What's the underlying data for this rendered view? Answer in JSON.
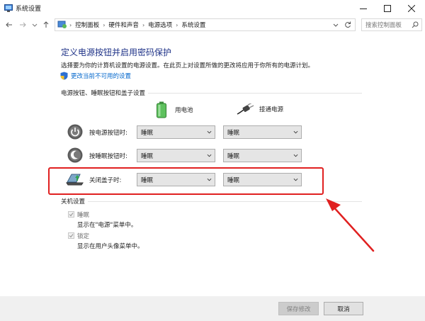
{
  "window": {
    "title": "系统设置"
  },
  "nav": {
    "breadcrumbs": [
      "控制面板",
      "硬件和声音",
      "电源选项",
      "系统设置"
    ],
    "search_placeholder": "搜索控制面板"
  },
  "page": {
    "heading": "定义电源按钮并启用密码保护",
    "subtitle": "选择要为你的计算机设置的电源设置。在此页上对设置所做的更改将应用于你所有的电源计划。",
    "change_link": "更改当前不可用的设置"
  },
  "power_section": {
    "title": "电源按钮、睡眠按钮和盖子设置",
    "col_battery": "用电池",
    "col_plugged": "接通电源",
    "rows": [
      {
        "label": "按电源按钮时:",
        "battery": "睡眠",
        "plugged": "睡眠"
      },
      {
        "label": "按睡眠按钮时:",
        "battery": "睡眠",
        "plugged": "睡眠"
      },
      {
        "label": "关闭盖子时:",
        "battery": "睡眠",
        "plugged": "睡眠"
      }
    ]
  },
  "shutdown_section": {
    "title": "关机设置",
    "items": [
      {
        "label": "睡眠",
        "desc": "显示在\"电源\"菜单中。",
        "checked": true
      },
      {
        "label": "锁定",
        "desc": "显示在用户头像菜单中。",
        "checked": true
      }
    ]
  },
  "buttons": {
    "save": "保存修改",
    "cancel": "取消"
  },
  "colors": {
    "heading": "#1e3287",
    "link": "#0066cc",
    "highlight": "#e02020"
  }
}
